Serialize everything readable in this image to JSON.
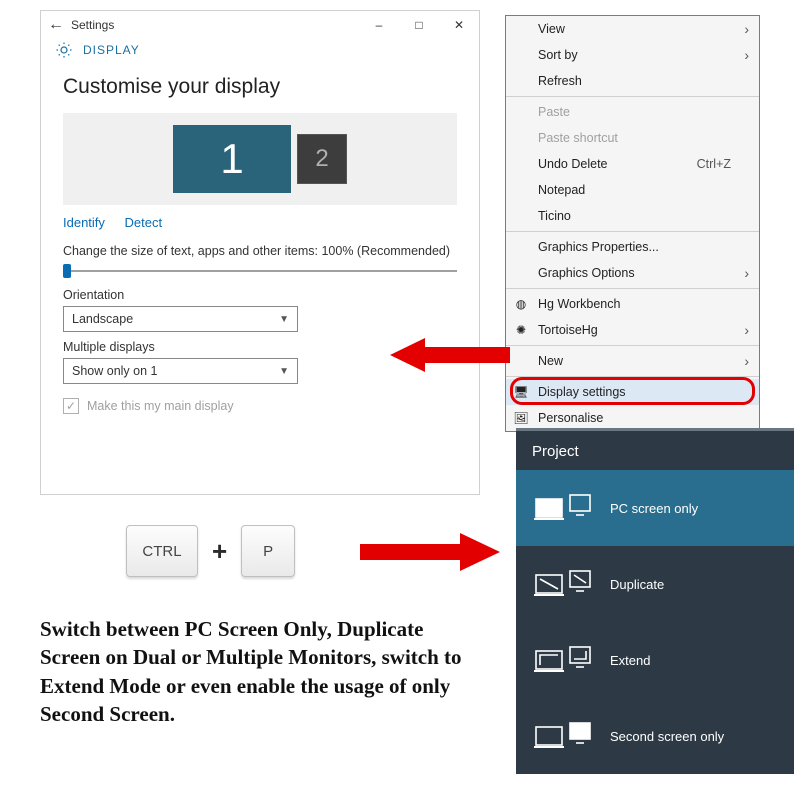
{
  "settings": {
    "window_title": "Settings",
    "section": "DISPLAY",
    "heading": "Customise your display",
    "monitor1": "1",
    "monitor2": "2",
    "identify": "Identify",
    "detect": "Detect",
    "scale_label": "Change the size of text, apps and other items: 100% (Recommended)",
    "orientation_label": "Orientation",
    "orientation_value": "Landscape",
    "multi_label": "Multiple displays",
    "multi_value": "Show only on 1",
    "main_display_label": "Make this my main display"
  },
  "context_menu": {
    "items": [
      {
        "label": "View",
        "submenu": true
      },
      {
        "label": "Sort by",
        "submenu": true
      },
      {
        "label": "Refresh"
      },
      {
        "sep": true
      },
      {
        "label": "Paste",
        "disabled": true
      },
      {
        "label": "Paste shortcut",
        "disabled": true
      },
      {
        "label": "Undo Delete",
        "shortcut": "Ctrl+Z"
      },
      {
        "label": "Notepad"
      },
      {
        "label": "Ticino"
      },
      {
        "sep": true
      },
      {
        "label": "Graphics Properties..."
      },
      {
        "label": "Graphics Options",
        "submenu": true
      },
      {
        "sep": true
      },
      {
        "label": "Hg Workbench",
        "icon": "hg"
      },
      {
        "label": "TortoiseHg",
        "icon": "tortoise",
        "submenu": true
      },
      {
        "sep": true
      },
      {
        "label": "New",
        "submenu": true
      },
      {
        "sep": true
      },
      {
        "label": "Display settings",
        "icon": "display",
        "highlight": true
      },
      {
        "label": "Personalise",
        "icon": "personalise"
      }
    ]
  },
  "keys": {
    "ctrl": "CTRL",
    "plus": "+",
    "p": "P"
  },
  "project": {
    "title": "Project",
    "options": [
      {
        "label": "PC screen only",
        "selected": true
      },
      {
        "label": "Duplicate"
      },
      {
        "label": "Extend"
      },
      {
        "label": "Second screen only"
      }
    ]
  },
  "caption": "Switch between PC Screen Only, Duplicate Screen on Dual or Multiple Monitors, switch to Extend Mode or even enable the usage of only Second Screen."
}
